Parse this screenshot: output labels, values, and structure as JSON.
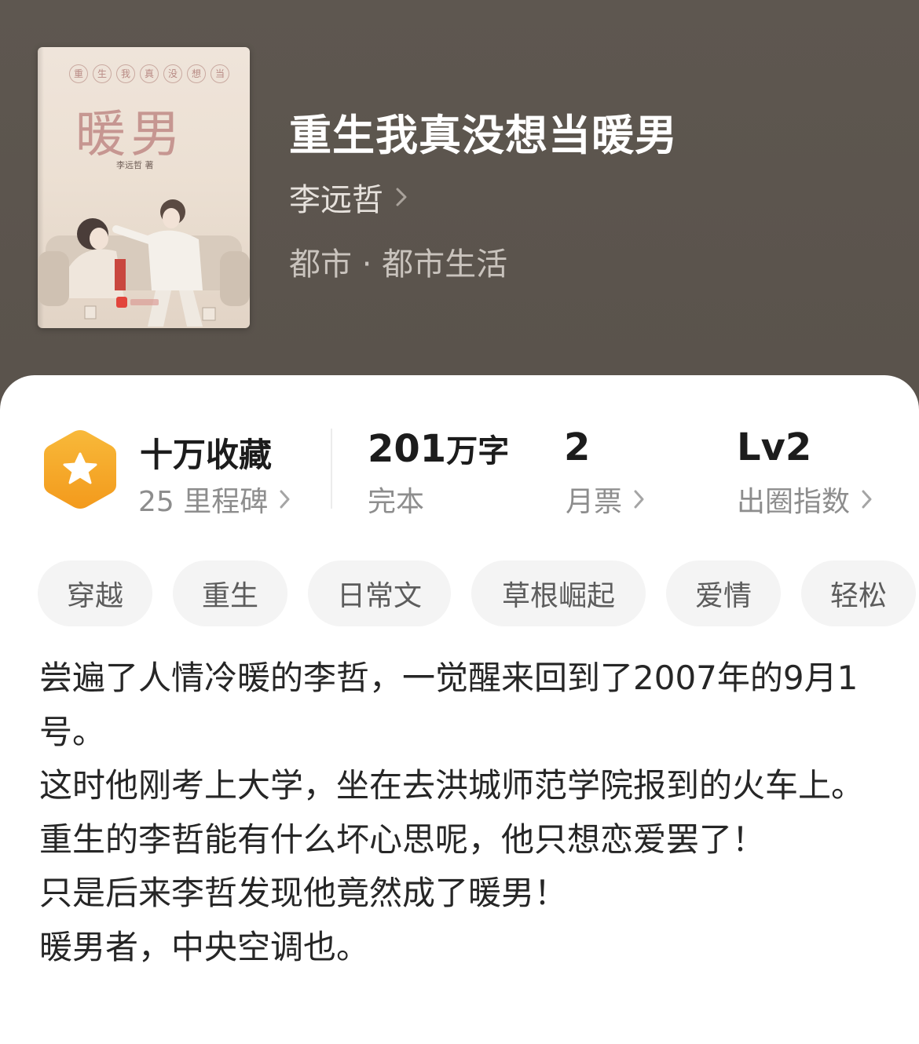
{
  "book": {
    "title": "重生我真没想当暖男",
    "author": "李远哲",
    "category": "都市 · 都市生活",
    "cover": {
      "small_title_chars": [
        "重",
        "生",
        "我",
        "真",
        "没",
        "想",
        "当"
      ],
      "big_title": "暖男",
      "author_line": "李远哲 著"
    }
  },
  "stats": {
    "collection_main": "十万收藏",
    "collection_sub": "25 里程碑",
    "words_main_num": "201",
    "words_main_unit": "万字",
    "words_sub": "完本",
    "tickets_main": "2",
    "tickets_sub": "月票",
    "level_main": "Lv2",
    "level_sub": "出圈指数"
  },
  "tags": [
    "穿越",
    "重生",
    "日常文",
    "草根崛起",
    "爱情",
    "轻松"
  ],
  "synopsis": [
    "尝遍了人情冷暖的李哲，一觉醒来回到了2007年的9月1号。",
    "这时他刚考上大学，坐在去洪城师范学院报到的火车上。",
    "重生的李哲能有什么坏心思呢，他只想恋爱罢了！",
    "只是后来李哲发现他竟然成了暖男！",
    "暖男者，中央空调也。"
  ],
  "colors": {
    "header_bg": "#5a534c",
    "milestone_icon": "#f5a623"
  }
}
